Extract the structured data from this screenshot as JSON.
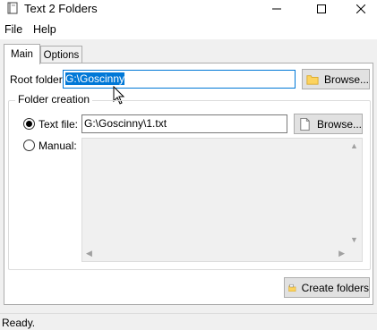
{
  "window": {
    "title": "Text 2 Folders"
  },
  "menu": {
    "items": [
      "File",
      "Help"
    ]
  },
  "tabs": [
    {
      "label": "Main",
      "active": true
    },
    {
      "label": "Options",
      "active": false
    }
  ],
  "root_folder": {
    "label": "Root folder:",
    "value": "G:\\Goscinny",
    "browse_label": "Browse..."
  },
  "folder_creation": {
    "title": "Folder creation",
    "text_file": {
      "label": "Text file:",
      "checked": true,
      "value": "G:\\Goscinny\\1.txt",
      "browse_label": "Browse..."
    },
    "manual": {
      "label": "Manual:",
      "checked": false,
      "value": ""
    }
  },
  "actions": {
    "create_label": "Create folders"
  },
  "status": {
    "text": "Ready."
  },
  "icons": {
    "app": "app-icon",
    "folder": "folder-icon",
    "document": "document-icon",
    "create": "create-folders-icon"
  },
  "colors": {
    "selection": "#0078d7",
    "folder": "#fcd35f",
    "button": "#e1e1e1"
  }
}
